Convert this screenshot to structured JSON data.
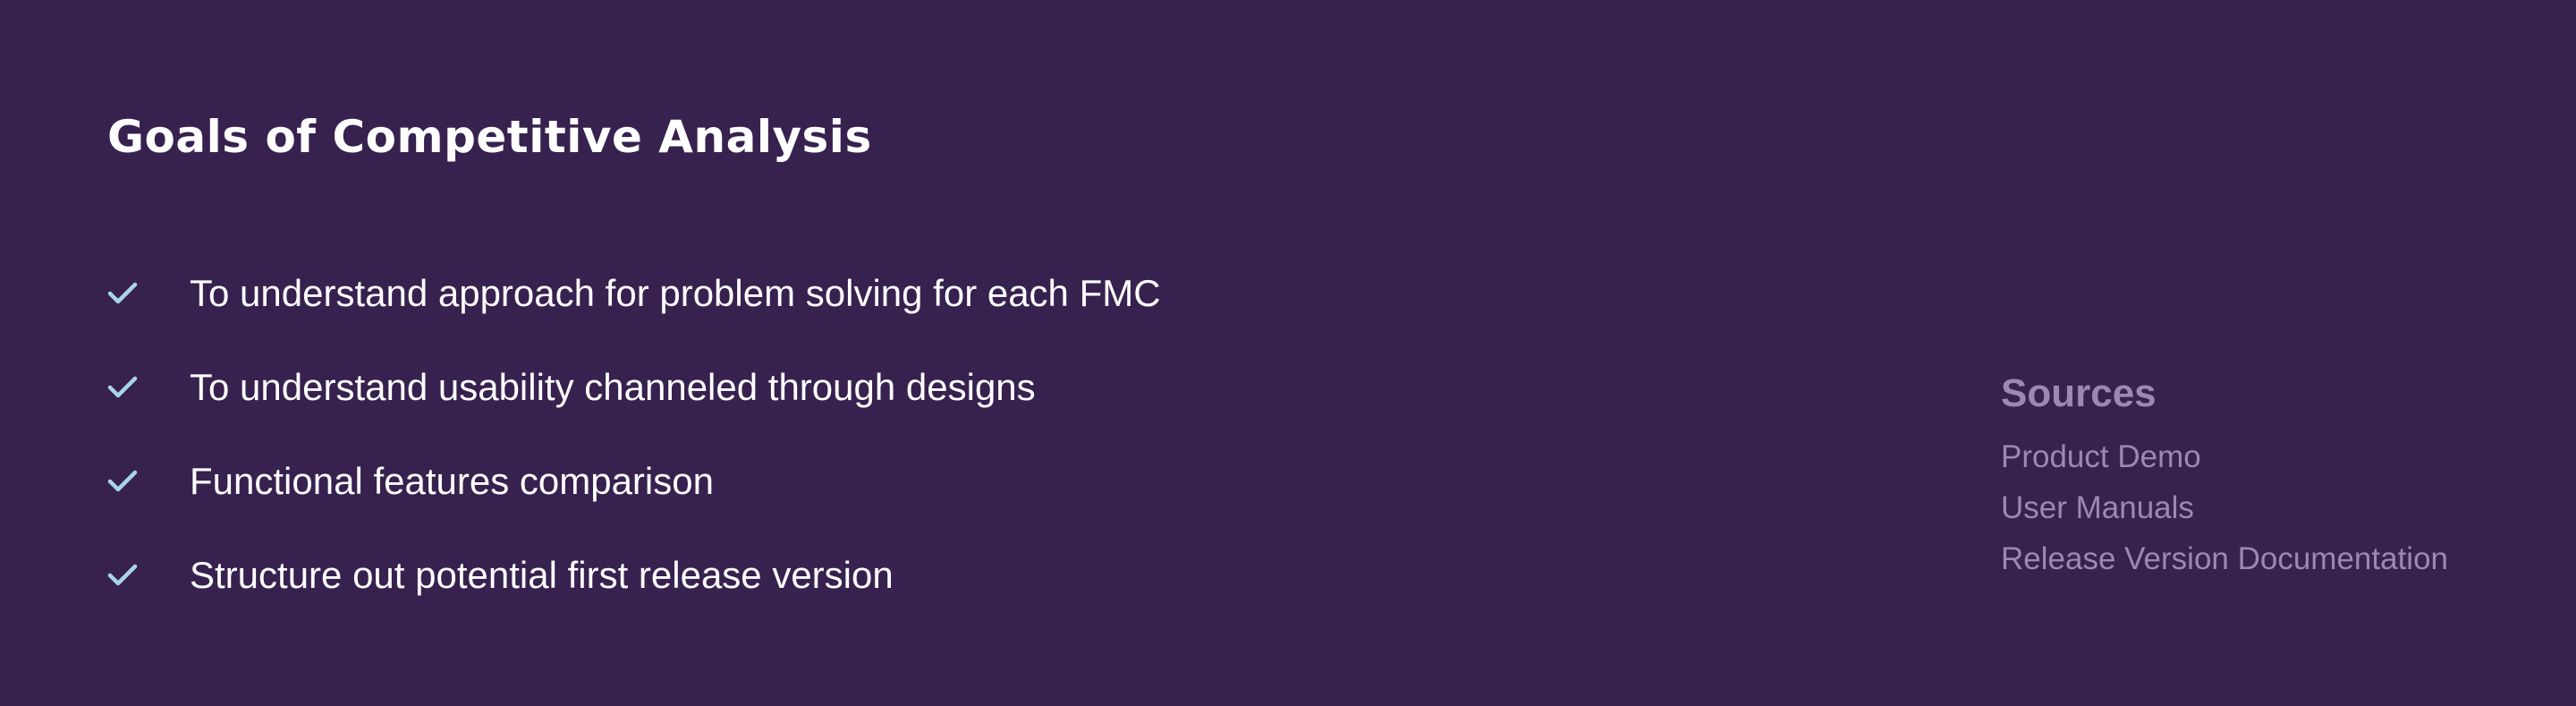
{
  "title": "Goals of Competitive Analysis",
  "goals": [
    {
      "text": "To understand approach for problem solving for each FMC",
      "icon": "check-icon"
    },
    {
      "text": "To understand usability channeled through designs",
      "icon": "check-icon"
    },
    {
      "text": "Functional features comparison",
      "icon": "check-icon"
    },
    {
      "text": "Structure out potential first release version",
      "icon": "check-icon"
    }
  ],
  "sources": {
    "title": "Sources",
    "items": [
      "Product Demo",
      "User Manuals",
      "Release Version Documentation"
    ]
  },
  "colors": {
    "background": "#37214f",
    "check": "#a9d4e8",
    "muted": "#9b88b5"
  }
}
